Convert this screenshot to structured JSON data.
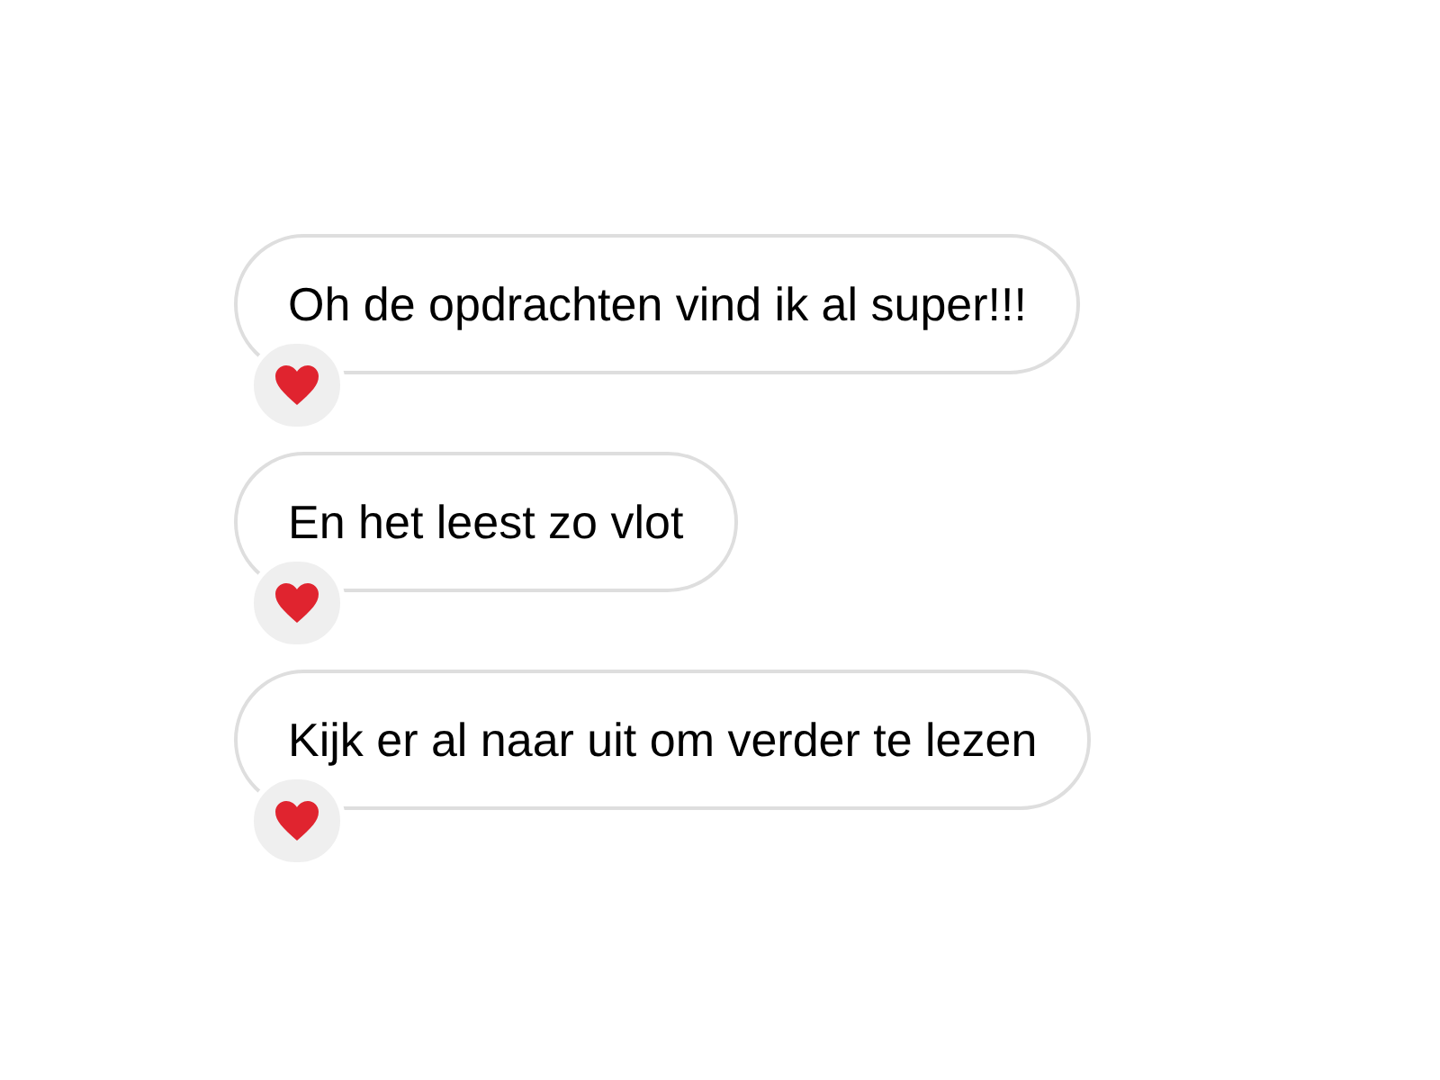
{
  "messages": [
    {
      "text": "Oh de opdrachten vind ik al super!!!",
      "reacted": true
    },
    {
      "text": "En het leest zo vlot",
      "reacted": true
    },
    {
      "text": "Kijk er al naar uit om verder te lezen",
      "reacted": true
    }
  ]
}
